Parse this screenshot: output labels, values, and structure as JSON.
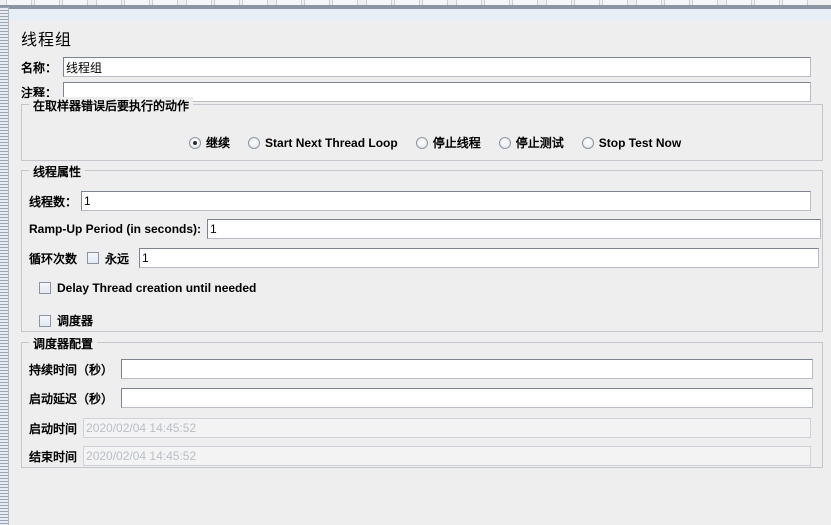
{
  "window": {
    "panel_title": "线程组",
    "accent_color": "#8c95a3",
    "background_color": "#eeeeee"
  },
  "toolbar": {
    "buttons": [
      "new",
      "templates",
      "open",
      "save",
      "cut",
      "copy",
      "paste",
      "expand",
      "collapse",
      "toggle",
      "start",
      "start-no-pause",
      "stop",
      "shutdown",
      "clear",
      "clear-all",
      "search",
      "reset-search",
      "function-helper",
      "help"
    ]
  },
  "name_field": {
    "label": "名称：",
    "value": "线程组",
    "placeholder": ""
  },
  "comment_field": {
    "label": "注释：",
    "value": "",
    "placeholder": ""
  },
  "on_error": {
    "title": "在取样器错误后要执行的动作",
    "selected": "继续",
    "options": [
      {
        "label": "继续",
        "selected": true
      },
      {
        "label": "Start Next Thread Loop",
        "selected": false
      },
      {
        "label": "停止线程",
        "selected": false
      },
      {
        "label": "停止测试",
        "selected": false
      },
      {
        "label": "Stop Test Now",
        "selected": false
      }
    ]
  },
  "thread_properties": {
    "title": "线程属性",
    "num_threads": {
      "label": "线程数：",
      "value": "1"
    },
    "ramp_up": {
      "label": "Ramp-Up Period (in seconds):",
      "value": "1"
    },
    "loop_count": {
      "label": "循环次数",
      "forever_label": "永远",
      "forever_checked": false,
      "value": "1"
    },
    "delay_thread_creation": {
      "label": "Delay Thread creation until needed",
      "checked": false
    },
    "scheduler_toggle": {
      "label": "调度器",
      "checked": false
    }
  },
  "scheduler": {
    "title": "调度器配置",
    "duration": {
      "label": "持续时间（秒）",
      "value": ""
    },
    "startup_delay": {
      "label": "启动延迟（秒）",
      "value": ""
    },
    "start_time": {
      "label": "启动时间",
      "value": "2020/02/04 14:45:52",
      "readonly": true
    },
    "end_time": {
      "label": "结束时间",
      "value": "2020/02/04 14:45:52",
      "readonly": true
    }
  }
}
